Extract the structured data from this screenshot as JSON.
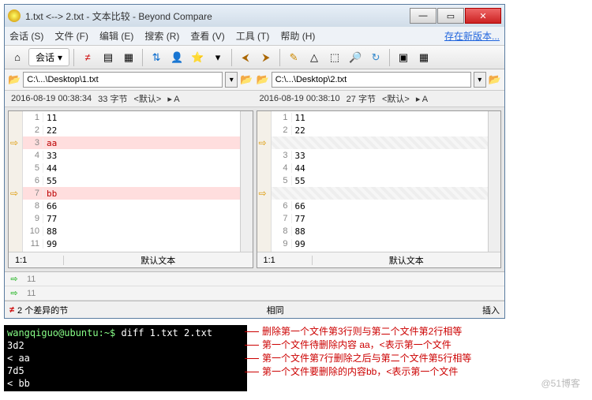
{
  "title": "1.txt <--> 2.txt - 文本比较 - Beyond Compare",
  "menu": {
    "session": "会话 (S)",
    "file": "文件 (F)",
    "edit": "编辑 (E)",
    "search": "搜索 (R)",
    "view": "查看 (V)",
    "tools": "工具 (T)",
    "help": "帮助 (H)",
    "new_version": "存在新版本..."
  },
  "toolbar": {
    "home": "⌂",
    "session_label": "会话",
    "dd": "▾",
    "ne": "≠",
    "thumb": "▤",
    "swap": "▦",
    "people": "⇅",
    "person": "👤",
    "star": "⭐",
    "dn": "▾",
    "copyL": "⮜",
    "copyR": "⮞",
    "pencil": "✎",
    "tri": "△",
    "sq": "⬚",
    "bin": "🔎",
    "reload": "↻",
    "pane": "▣",
    "grid": "▦"
  },
  "paths": {
    "left": "C:\\...\\Desktop\\1.txt",
    "right": "C:\\...\\Desktop\\2.txt",
    "open": "📂",
    "down": "▾"
  },
  "info": {
    "left_ts": "2016-08-19 00:38:34",
    "left_size": "33 字节",
    "right_ts": "2016-08-19 00:38:10",
    "right_size": "27 字节",
    "enc": "<默认>",
    "a": "▸ A"
  },
  "left_lines": [
    {
      "n": "1",
      "t": "11"
    },
    {
      "n": "2",
      "t": "22"
    },
    {
      "n": "3",
      "t": "aa",
      "diff": true,
      "ptr": true
    },
    {
      "n": "4",
      "t": "33"
    },
    {
      "n": "5",
      "t": "44"
    },
    {
      "n": "6",
      "t": "55"
    },
    {
      "n": "7",
      "t": "bb",
      "diff": true,
      "ptr": true
    },
    {
      "n": "8",
      "t": "66"
    },
    {
      "n": "9",
      "t": "77"
    },
    {
      "n": "10",
      "t": "88"
    },
    {
      "n": "11",
      "t": "99"
    },
    {
      "n": "-",
      "t": ""
    }
  ],
  "right_lines": [
    {
      "n": "1",
      "t": "11"
    },
    {
      "n": "2",
      "t": "22"
    },
    {
      "n": "",
      "t": "",
      "hatch": true,
      "ptr": true
    },
    {
      "n": "3",
      "t": "33"
    },
    {
      "n": "4",
      "t": "44"
    },
    {
      "n": "5",
      "t": "55"
    },
    {
      "n": "",
      "t": "",
      "hatch": true,
      "ptr": true
    },
    {
      "n": "6",
      "t": "66"
    },
    {
      "n": "7",
      "t": "77"
    },
    {
      "n": "8",
      "t": "88"
    },
    {
      "n": "9",
      "t": "99"
    },
    {
      "n": "-",
      "t": ""
    }
  ],
  "footer": {
    "pos": "1:1",
    "enc": "默认文本"
  },
  "bottom": {
    "r1": "11",
    "r2": "11",
    "mk": "⇨"
  },
  "status": {
    "diffs": "2 个差异的节",
    "same": "相同",
    "insert": "插入"
  },
  "terminal": {
    "prompt": "wangqiguo@ubuntu:~$",
    "cmd": "diff 1.txt 2.txt",
    "out": [
      "3d2",
      "< aa",
      "7d5",
      "< bb"
    ]
  },
  "annot": [
    "删除第一个文件第3行则与第二个文件第2行相等",
    "第一个文件待删除内容 aa，<表示第一个文件",
    "第一个文件第7行删除之后与第二个文件第5行相等",
    "第一个文件要删除的内容bb，<表示第一个文件"
  ],
  "watermark": "@51博客"
}
